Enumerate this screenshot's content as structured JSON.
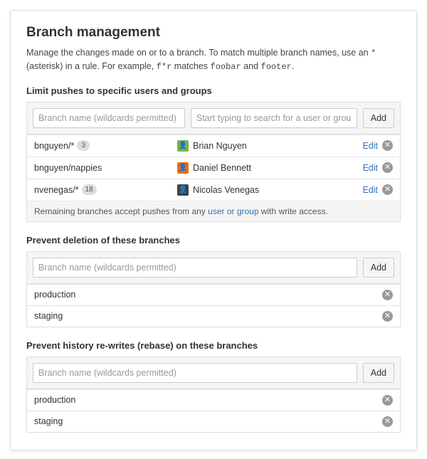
{
  "header": {
    "title": "Branch management",
    "desc_pre": "Manage the changes made on or to a branch. To match multiple branch names, use an ",
    "desc_code1": "*",
    "desc_mid1": " (asterisk) in a rule. For example, ",
    "desc_code2": "f*r",
    "desc_mid2": " matches ",
    "desc_code3": "foobar",
    "desc_mid3": " and ",
    "desc_code4": "footer",
    "desc_end": "."
  },
  "section_push": {
    "heading": "Limit pushes to specific users and groups",
    "branch_placeholder": "Branch name (wildcards permitted)",
    "user_placeholder": "Start typing to search for a user or group",
    "add_label": "Add",
    "rows": [
      {
        "branch": "bnguyen/*",
        "count": "3",
        "user": "Brian Nguyen",
        "avatar_bg": "#7cb342"
      },
      {
        "branch": "bnguyen/nappies",
        "count": "",
        "user": "Daniel Bennett",
        "avatar_bg": "#ef6c00"
      },
      {
        "branch": "nvenegas/*",
        "count": "18",
        "user": "Nicolas Venegas",
        "avatar_bg": "#424242"
      }
    ],
    "edit_label": "Edit",
    "footer_pre": "Remaining branches accept pushes from any ",
    "footer_link": "user or group",
    "footer_post": " with write access."
  },
  "section_delete": {
    "heading": "Prevent deletion of these branches",
    "branch_placeholder": "Branch name (wildcards permitted)",
    "add_label": "Add",
    "rows": [
      {
        "name": "production"
      },
      {
        "name": "staging"
      }
    ]
  },
  "section_rebase": {
    "heading": "Prevent history re-writes (rebase) on these branches",
    "branch_placeholder": "Branch name (wildcards permitted)",
    "add_label": "Add",
    "rows": [
      {
        "name": "production"
      },
      {
        "name": "staging"
      }
    ]
  }
}
